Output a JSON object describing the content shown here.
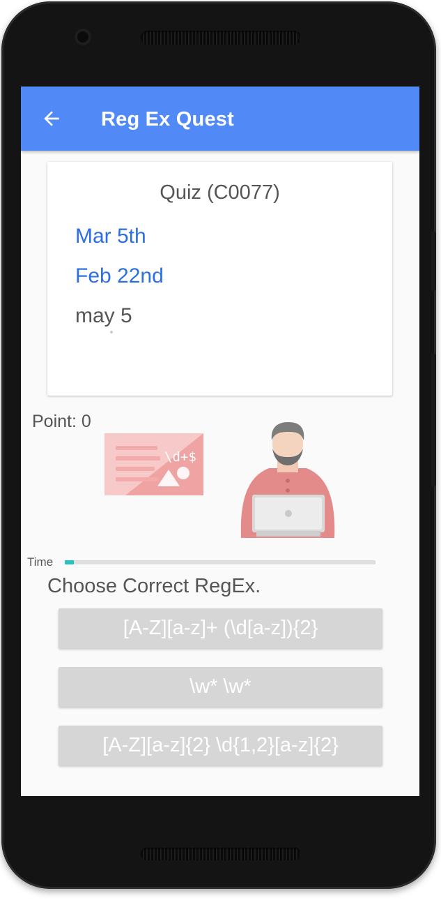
{
  "app": {
    "title": "Reg Ex Quest",
    "back_icon": "arrow-left-icon"
  },
  "quiz": {
    "title": "Quiz  (C0077)",
    "lines": [
      {
        "text": "Mar 5th",
        "highlighted": true
      },
      {
        "text": "Feb 22nd",
        "highlighted": true
      },
      {
        "text": "may 5",
        "highlighted": false
      }
    ]
  },
  "score": {
    "label": "Point: 0"
  },
  "illustration": {
    "card_text": "\\d+$",
    "card_icon": "regex-card-icon",
    "person_icon": "person-at-laptop-icon"
  },
  "timer": {
    "label": "Time",
    "progress": 0.03
  },
  "question": {
    "prompt": "Choose Correct RegEx.",
    "options": [
      "[A-Z][a-z]+ (\\d[a-z]){2}",
      "\\w* \\w*",
      "[A-Z][a-z]{2} \\d{1,2}[a-z]{2}"
    ]
  },
  "colors": {
    "appbar": "#5189f7",
    "highlight_text": "#2d6fe0",
    "option_bg": "#d6d6d6",
    "timer_fill": "#22c4bd",
    "illustration": "#e58a8a"
  }
}
